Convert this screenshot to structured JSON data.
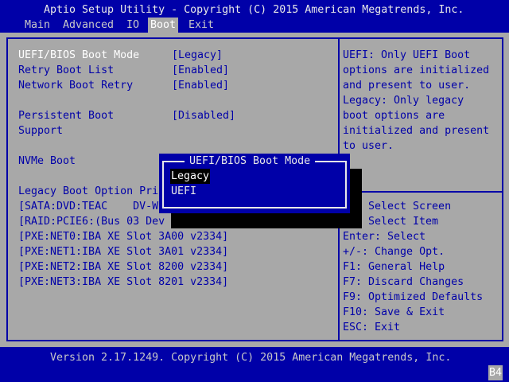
{
  "header": {
    "title": "Aptio Setup Utility - Copyright (C) 2015 American Megatrends, Inc.",
    "tabs": [
      {
        "label": "Main",
        "active": false
      },
      {
        "label": "Advanced",
        "active": false
      },
      {
        "label": "IO",
        "active": false
      },
      {
        "label": "Boot",
        "active": true
      },
      {
        "label": "Exit",
        "active": false
      }
    ]
  },
  "settings": [
    {
      "label": "UEFI/BIOS Boot Mode",
      "value": "[Legacy]",
      "selected": true
    },
    {
      "label": "Retry Boot List",
      "value": "[Enabled]"
    },
    {
      "label": "Network Boot Retry",
      "value": "[Enabled]"
    },
    {
      "label": "Persistent Boot",
      "label2": "Support",
      "value": "[Disabled]"
    },
    {
      "label": "NVMe Boot"
    }
  ],
  "legacy_priorities": {
    "heading": "Legacy Boot Option Pri",
    "items": [
      "[SATA:DVD:TEAC    DV-W",
      "[RAID:PCIE6:(Bus 03 Dev",
      "[PXE:NET0:IBA XE Slot 3A00 v2334]",
      "[PXE:NET1:IBA XE Slot 3A01 v2334]",
      "[PXE:NET2:IBA XE Slot 8200 v2334]",
      "[PXE:NET3:IBA XE Slot 8201 v2334]"
    ]
  },
  "help": {
    "description": [
      "UEFI: Only UEFI Boot",
      "options are initialized",
      "and present to user.",
      "Legacy: Only legacy",
      "boot options are",
      "initialized and present",
      "to user."
    ],
    "keys": [
      "Select Screen",
      "Select Item",
      "Enter: Select",
      "+/-: Change Opt.",
      "F1: General Help",
      "F7: Discard Changes",
      "F9: Optimized Defaults",
      "F10: Save & Exit",
      "ESC: Exit"
    ]
  },
  "popup": {
    "title": "UEFI/BIOS Boot Mode",
    "options": [
      "Legacy",
      "UEFI"
    ],
    "highlighted": "Legacy"
  },
  "footer": {
    "version": "Version 2.17.1249. Copyright (C) 2015 American Megatrends, Inc.",
    "code": "B4"
  },
  "colors": {
    "bar": "#0000a8",
    "background": "#a8a8a8",
    "text": "#0000a8",
    "selected": "#ffffff"
  }
}
